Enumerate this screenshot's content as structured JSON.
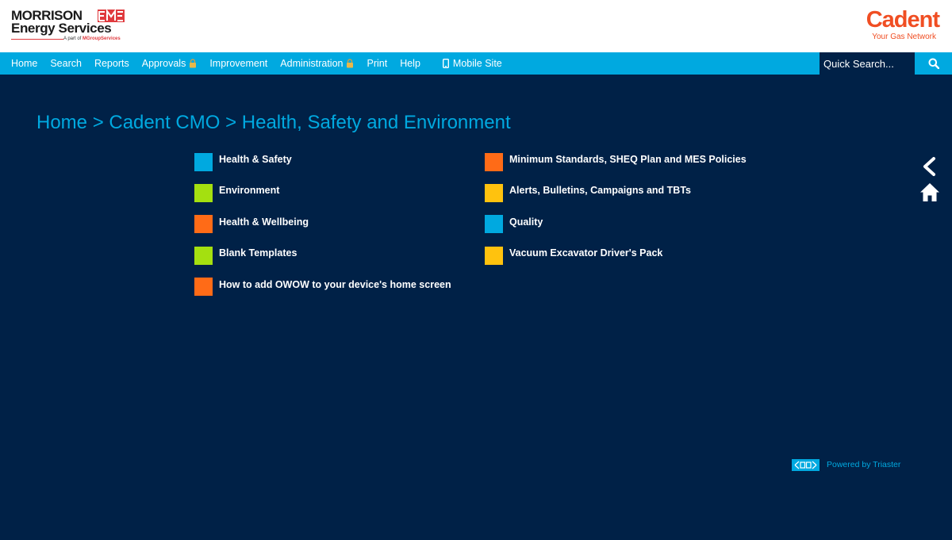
{
  "header": {
    "left_logo": {
      "line1": "MORRISON",
      "line2": "Energy Services",
      "tagline_prefix": "A part of ",
      "tagline_brand": "MGroupServices"
    },
    "right_logo": {
      "name": "Cadent",
      "tagline": "Your Gas Network"
    }
  },
  "nav": {
    "items": [
      {
        "label": "Home"
      },
      {
        "label": "Search"
      },
      {
        "label": "Reports"
      },
      {
        "label": "Approvals"
      },
      {
        "label": "Improvement"
      },
      {
        "label": "Administration"
      },
      {
        "label": "Print"
      },
      {
        "label": "Help"
      },
      {
        "label": "Mobile Site"
      }
    ],
    "search_placeholder": "Quick Search..."
  },
  "breadcrumb": "Home > Cadent CMO > Health, Safety and Environment",
  "menu": {
    "left": [
      {
        "label": "Health & Safety",
        "color": "#00a9e0"
      },
      {
        "label": "Environment",
        "color": "#a4e010"
      },
      {
        "label": "Health & Wellbeing",
        "color": "#ff6b17"
      },
      {
        "label": "Blank Templates",
        "color": "#a4e010"
      },
      {
        "label": "How to add OWOW to your device's home screen",
        "color": "#ff6b17"
      }
    ],
    "right": [
      {
        "label": "Minimum Standards, SHEQ Plan and MES Policies",
        "color": "#ff6b17"
      },
      {
        "label": "Alerts, Bulletins, Campaigns and TBTs",
        "color": "#ffc20e"
      },
      {
        "label": "Quality",
        "color": "#00a9e0"
      },
      {
        "label": "Vacuum Excavator Driver's Pack",
        "color": "#ffc20e"
      }
    ]
  },
  "footer": {
    "powered_by": "Powered by Triaster"
  },
  "colors": {
    "background": "#002147",
    "nav_bar": "#00a9e0",
    "accent": "#00a9e0",
    "cadent_orange": "#f04e23",
    "mes_red": "#e03a3e"
  }
}
